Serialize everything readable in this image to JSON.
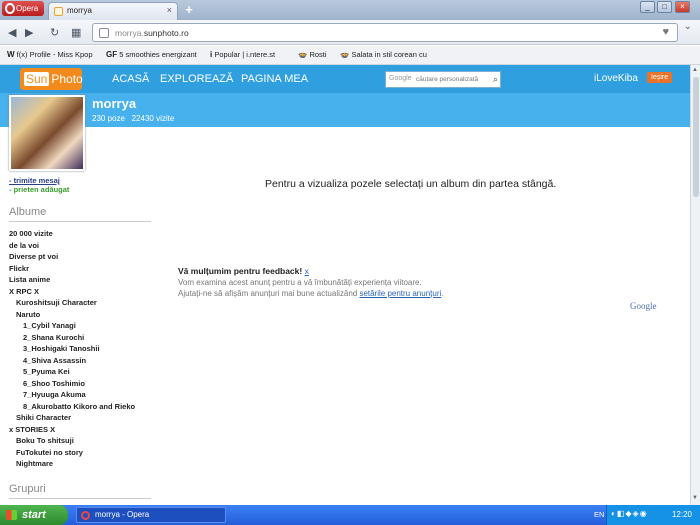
{
  "browser": {
    "opera_label": "Opera",
    "tab_title": "morrya",
    "tab_close": "×",
    "new_tab": "+",
    "url_dim": "morrya.",
    "url_domain": "sunphoto.ro",
    "window_buttons": [
      "_",
      "□",
      "×"
    ]
  },
  "bookmarks": [
    {
      "prefix": "W",
      "label": "f(x) Profile - Miss Kpop"
    },
    {
      "prefix": "GF",
      "label": "5 smoothies energizant"
    },
    {
      "prefix": "i",
      "label": "Popular | i.ntere.st"
    },
    {
      "prefix": "🍲",
      "label": "Rosti"
    },
    {
      "prefix": "🍲",
      "label": "Salata in stil corean cu"
    }
  ],
  "site": {
    "logo_s": "Sun",
    "logo_rest": "Photo",
    "nav": [
      "ACASĂ",
      "EXPLOREAZĂ",
      "PAGINA MEA"
    ],
    "search_brand": "Google",
    "search_placeholder": "căutare personalizată",
    "user": "iLoveKiba",
    "logout": "Ieșire"
  },
  "profile": {
    "name": "morrya",
    "photos": "230 poze",
    "visits": "22430 vizite",
    "action_send": "- trimite mesaj",
    "action_friend": "- prieten adăugat"
  },
  "sidebar": {
    "albums_title": "Albume",
    "albums": [
      "20 000 vizite",
      "de la voi",
      "Diverse pt voi",
      "Flickr",
      "Lista anime",
      "X RPC X",
      "Kuroshitsuji Character",
      "Naruto",
      "1_Cybil Yanagi",
      "2_Shana Kurochi",
      "3_Hoshigaki Tanoshii",
      "4_Shiva Assassin",
      "5_Pyuma Kei",
      "6_Shoo Toshimio",
      "7_Hyuuga Akuma",
      "8_Akurobatto Kikoro and Rieko",
      "Shiki Character",
      "x STORIES X",
      "Boku To shitsuji",
      "FuTokutei no story",
      "Nightmare"
    ],
    "album_indent": [
      0,
      0,
      0,
      0,
      0,
      0,
      1,
      1,
      2,
      2,
      2,
      2,
      2,
      2,
      2,
      2,
      1,
      0,
      1,
      1,
      1
    ],
    "groups_title": "Grupuri"
  },
  "main": {
    "message": "Pentru a vizualiza pozele selectați un album din partea stângă.",
    "feedback_title": "Vă mulțumim pentru feedback!",
    "feedback_x": "x",
    "feedback_line1": "Vom examina acest anunț pentru a vă îmbunătăți experiența viitoare.",
    "feedback_line2_prefix": "Ajutați-ne să afișăm anunțuri mai bune actualizând ",
    "feedback_link": "setările pentru anunțuri",
    "feedback_line2_suffix": ".",
    "google": "Google"
  },
  "taskbar": {
    "start": "start",
    "task": "morrya - Opera",
    "lang": "EN",
    "clock": "12:20"
  }
}
